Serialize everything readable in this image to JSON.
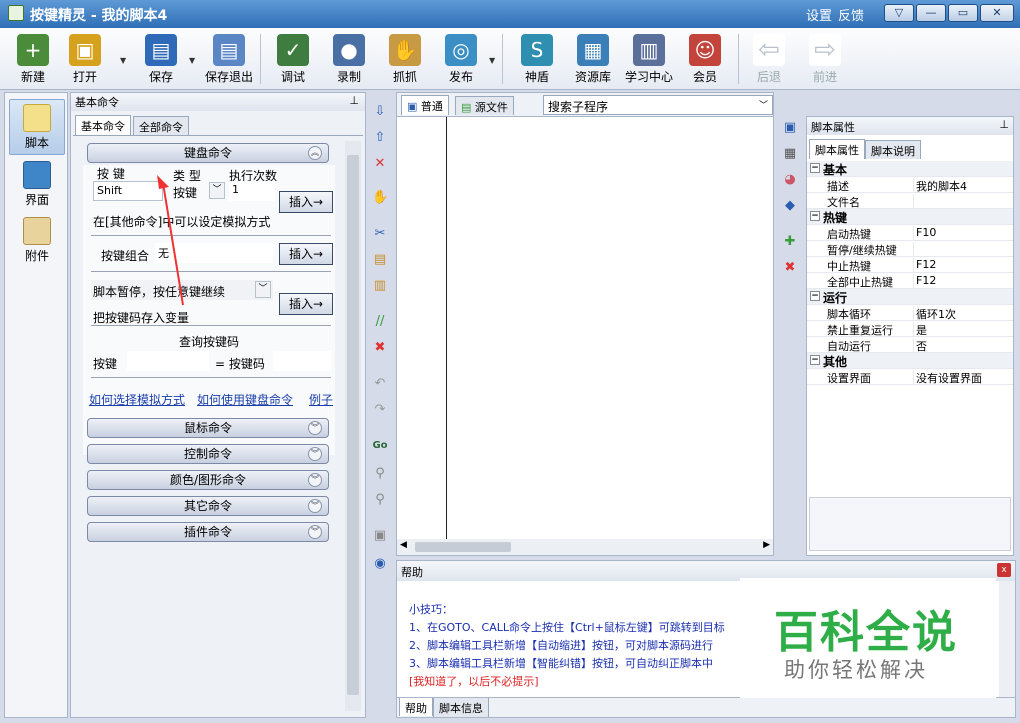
{
  "window": {
    "app_name": "按键精灵",
    "script_name": "我的脚本4",
    "title_sep": " - ",
    "settings": "设置",
    "feedback": "反馈"
  },
  "toolbar": {
    "items": [
      {
        "label": "新建",
        "icon": "new-file-icon",
        "color": "#4b8c3b"
      },
      {
        "label": "打开",
        "icon": "open-folder-icon",
        "color": "#d6a21d"
      },
      {
        "label": "保存",
        "icon": "save-disk-icon",
        "color": "#2f6ab8"
      },
      {
        "label": "保存退出",
        "icon": "save-exit-icon",
        "color": "#5b86c6"
      },
      {
        "label": "调试",
        "icon": "debug-icon",
        "color": "#3f7c3f"
      },
      {
        "label": "录制",
        "icon": "record-camera-icon",
        "color": "#4a6fa5"
      },
      {
        "label": "抓抓",
        "icon": "grab-hand-icon",
        "color": "#c89a43"
      },
      {
        "label": "发布",
        "icon": "publish-globe-icon",
        "color": "#3b8fc4"
      },
      {
        "label": "神盾",
        "icon": "shield-icon",
        "color": "#2f8fb0"
      },
      {
        "label": "资源库",
        "icon": "resource-library-icon",
        "color": "#3b7fb8"
      },
      {
        "label": "学习中心",
        "icon": "study-center-icon",
        "color": "#5a6f9a"
      },
      {
        "label": "会员",
        "icon": "member-icon",
        "color": "#c2443a"
      },
      {
        "label": "后退",
        "icon": "back-arrow-icon",
        "color": "#b9c2cc"
      },
      {
        "label": "前进",
        "icon": "forward-arrow-icon",
        "color": "#b9c2cc"
      }
    ]
  },
  "leftnav": {
    "items": [
      {
        "label": "脚本"
      },
      {
        "label": "界面"
      },
      {
        "label": "附件"
      }
    ]
  },
  "cmdpanel": {
    "header": "基本命令",
    "tabs": [
      "基本命令",
      "全部命令"
    ],
    "keyboard_group": "键盘命令",
    "col_key": "按  键",
    "col_type": "类  型",
    "col_times": "执行次数",
    "key_value": "Shift",
    "type_value": "按键",
    "times_value": "1",
    "insert": "插入→",
    "hint_other": "在[其他命令]中可以设定模拟方式",
    "combo_label": "按键组合",
    "combo_value": "无",
    "pause_value": "脚本暂停，按任意键继续",
    "save_key_var": "把按键码存入变量",
    "query_title": "查询按键码",
    "query_key": "按键",
    "query_code": "= 按键码",
    "link1": "如何选择模拟方式",
    "link2": "如何使用键盘命令",
    "link3": "例子",
    "groups": [
      "鼠标命令",
      "控制命令",
      "颜色/图形命令",
      "其它命令",
      "插件命令"
    ]
  },
  "editor": {
    "tab_normal": "普通",
    "tab_source": "源文件",
    "search_placeholder": "搜索子程序"
  },
  "props": {
    "header": "脚本属性",
    "tabs": [
      "脚本属性",
      "脚本说明"
    ],
    "rows": [
      {
        "cat": true,
        "k": "基本"
      },
      {
        "k": "描述",
        "v": "我的脚本4"
      },
      {
        "k": "文件名",
        "v": ""
      },
      {
        "cat": true,
        "k": "热键"
      },
      {
        "k": "启动热键",
        "v": "F10"
      },
      {
        "k": "暂停/继续热键",
        "v": ""
      },
      {
        "k": "中止热键",
        "v": "F12"
      },
      {
        "k": "全部中止热键",
        "v": "F12"
      },
      {
        "cat": true,
        "k": "运行"
      },
      {
        "k": "脚本循环",
        "v": "循环1次"
      },
      {
        "k": "禁止重复运行",
        "v": "是"
      },
      {
        "k": "自动运行",
        "v": "否"
      },
      {
        "cat": true,
        "k": "其他"
      },
      {
        "k": "设置界面",
        "v": "没有设置界面"
      }
    ]
  },
  "help": {
    "header": "帮助",
    "tips_title": "小技巧：",
    "lines": [
      "1、在GOTO、CALL命令上按住【Ctrl+鼠标左键】可跳转到目标",
      "2、脚本编辑工具栏新增【自动缩进】按钮，可对脚本源码进行",
      "3、脚本编辑工具栏新增【智能纠错】按钮，可自动纠正脚本中"
    ],
    "dismiss": "[我知道了，以后不必提示]",
    "tabs": [
      "帮助",
      "脚本信息"
    ]
  },
  "watermark": {
    "main": "百科全说",
    "sub": "助你轻松解决"
  }
}
